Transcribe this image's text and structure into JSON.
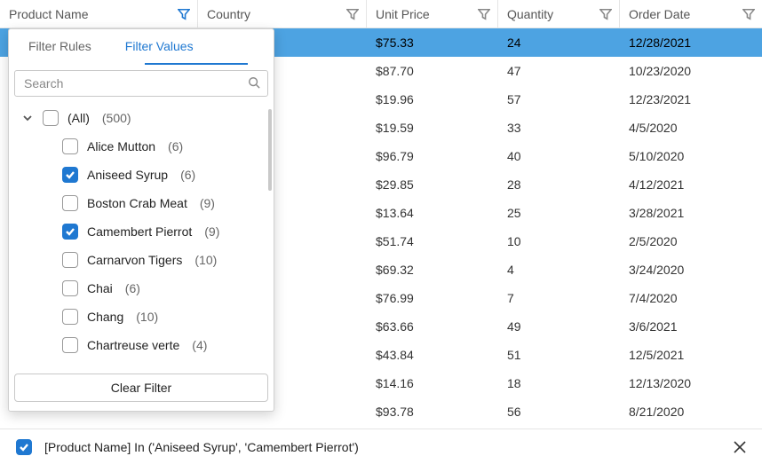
{
  "columns": [
    {
      "label": "Product Name",
      "filtered": true
    },
    {
      "label": "Country",
      "filtered": false
    },
    {
      "label": "Unit Price",
      "filtered": false
    },
    {
      "label": "Quantity",
      "filtered": false
    },
    {
      "label": "Order Date",
      "filtered": false
    }
  ],
  "rows": [
    {
      "unit_price": "$75.33",
      "quantity": "24",
      "order_date": "12/28/2021",
      "selected": true
    },
    {
      "unit_price": "$87.70",
      "quantity": "47",
      "order_date": "10/23/2020"
    },
    {
      "unit_price": "$19.96",
      "quantity": "57",
      "order_date": "12/23/2021"
    },
    {
      "unit_price": "$19.59",
      "quantity": "33",
      "order_date": "4/5/2020"
    },
    {
      "unit_price": "$96.79",
      "quantity": "40",
      "order_date": "5/10/2020"
    },
    {
      "unit_price": "$29.85",
      "quantity": "28",
      "order_date": "4/12/2021"
    },
    {
      "unit_price": "$13.64",
      "quantity": "25",
      "order_date": "3/28/2021"
    },
    {
      "unit_price": "$51.74",
      "quantity": "10",
      "order_date": "2/5/2020"
    },
    {
      "unit_price": "$69.32",
      "quantity": "4",
      "order_date": "3/24/2020"
    },
    {
      "unit_price": "$76.99",
      "quantity": "7",
      "order_date": "7/4/2020"
    },
    {
      "unit_price": "$63.66",
      "quantity": "49",
      "order_date": "3/6/2021"
    },
    {
      "unit_price": "$43.84",
      "quantity": "51",
      "order_date": "12/5/2021"
    },
    {
      "unit_price": "$14.16",
      "quantity": "18",
      "order_date": "12/13/2020"
    },
    {
      "unit_price": "$93.78",
      "quantity": "56",
      "order_date": "8/21/2020"
    }
  ],
  "popup": {
    "tabs": {
      "rules": "Filter Rules",
      "values": "Filter Values"
    },
    "search_placeholder": "Search",
    "all_label": "(All)",
    "all_count": "(500)",
    "items": [
      {
        "label": "Alice Mutton",
        "count": "(6)",
        "checked": false
      },
      {
        "label": "Aniseed Syrup",
        "count": "(6)",
        "checked": true
      },
      {
        "label": "Boston Crab Meat",
        "count": "(9)",
        "checked": false
      },
      {
        "label": "Camembert Pierrot",
        "count": "(9)",
        "checked": true
      },
      {
        "label": "Carnarvon Tigers",
        "count": "(10)",
        "checked": false
      },
      {
        "label": "Chai",
        "count": "(6)",
        "checked": false
      },
      {
        "label": "Chang",
        "count": "(10)",
        "checked": false
      },
      {
        "label": "Chartreuse verte",
        "count": "(4)",
        "checked": false
      }
    ],
    "clear_label": "Clear Filter"
  },
  "filter_bar": {
    "expression": "[Product Name] In ('Aniseed Syrup', 'Camembert Pierrot')"
  }
}
